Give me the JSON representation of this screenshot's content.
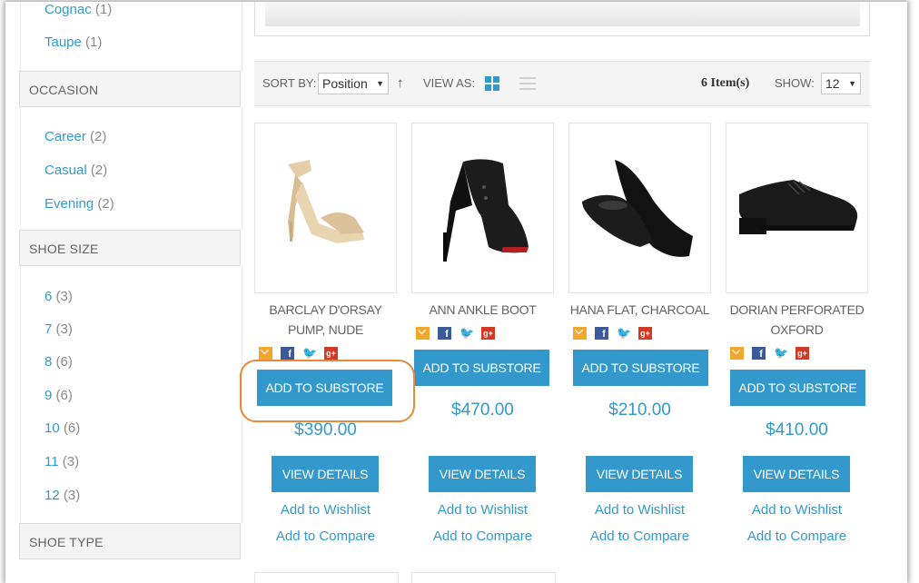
{
  "sidebar": {
    "colors": [
      {
        "label": "Cognac",
        "count": "(1)"
      },
      {
        "label": "Taupe",
        "count": "(1)"
      }
    ],
    "occasion": {
      "heading": "OCCASION",
      "items": [
        {
          "label": "Career",
          "count": "(2)"
        },
        {
          "label": "Casual",
          "count": "(2)"
        },
        {
          "label": "Evening",
          "count": "(2)"
        }
      ]
    },
    "shoe_size": {
      "heading": "SHOE SIZE",
      "items": [
        {
          "label": "6",
          "count": "(3)"
        },
        {
          "label": "7",
          "count": "(3)"
        },
        {
          "label": "8",
          "count": "(6)"
        },
        {
          "label": "9",
          "count": "(6)"
        },
        {
          "label": "10",
          "count": "(6)"
        },
        {
          "label": "11",
          "count": "(3)"
        },
        {
          "label": "12",
          "count": "(3)"
        }
      ]
    },
    "shoe_type": {
      "heading": "SHOE TYPE"
    }
  },
  "toolbar": {
    "sort_label": "SORT BY:",
    "sort_value": "Position",
    "view_label": "VIEW AS:",
    "item_count": "6 Item(s)",
    "show_label": "SHOW:",
    "show_value": "12"
  },
  "products": [
    {
      "name_line1": "BARCLAY D'ORSAY",
      "name_line2": "PUMP, NUDE",
      "price": "$390.00",
      "add_substore": "ADD TO SUBSTORE",
      "view_details": "VIEW DETAILS",
      "wishlist": "Add to Wishlist",
      "compare": "Add to Compare"
    },
    {
      "name_line1": "ANN ANKLE BOOT",
      "name_line2": "",
      "price": "$470.00",
      "add_substore": "ADD TO SUBSTORE",
      "view_details": "VIEW DETAILS",
      "wishlist": "Add to Wishlist",
      "compare": "Add to Compare"
    },
    {
      "name_line1": "HANA FLAT, CHARCOAL",
      "name_line2": "",
      "price": "$210.00",
      "add_substore": "ADD TO SUBSTORE",
      "view_details": "VIEW DETAILS",
      "wishlist": "Add to Wishlist",
      "compare": "Add to Compare"
    },
    {
      "name_line1": "DORIAN PERFORATED",
      "name_line2": "OXFORD",
      "price": "$410.00",
      "add_substore": "ADD TO SUBSTORE",
      "view_details": "VIEW DETAILS",
      "wishlist": "Add to Wishlist",
      "compare": "Add to Compare"
    }
  ],
  "icons": [
    "email-icon",
    "facebook-icon",
    "twitter-icon",
    "google-plus-icon",
    "sort-arrow-icon",
    "grid-view-icon",
    "list-view-icon"
  ],
  "colors": {
    "accent": "#3399cc",
    "highlight": "#e8893a",
    "text": "#636363"
  }
}
